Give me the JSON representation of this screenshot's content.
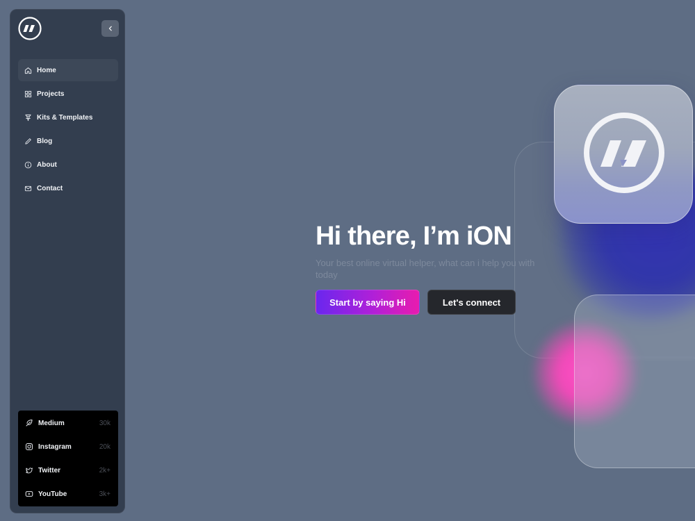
{
  "sidebar": {
    "logo_icon": "double-slash-logo-icon",
    "collapse_icon": "chevron-left-icon",
    "nav": [
      {
        "label": "Home",
        "icon": "home-icon",
        "active": true
      },
      {
        "label": "Projects",
        "icon": "grid-icon",
        "active": false
      },
      {
        "label": "Kits & Templates",
        "icon": "pen-nib-icon",
        "active": false
      },
      {
        "label": "Blog",
        "icon": "pencil-icon",
        "active": false
      },
      {
        "label": "About",
        "icon": "info-icon",
        "active": false
      },
      {
        "label": "Contact",
        "icon": "mail-icon",
        "active": false
      }
    ],
    "socials": [
      {
        "label": "Medium",
        "count": "30k",
        "icon": "feather-icon"
      },
      {
        "label": "Instagram",
        "count": "20k",
        "icon": "instagram-icon"
      },
      {
        "label": "Twitter",
        "count": "2k+",
        "icon": "twitter-icon"
      },
      {
        "label": "YouTube",
        "count": "3k+",
        "icon": "youtube-icon"
      }
    ]
  },
  "hero": {
    "title": "Hi there, I’m  iON",
    "subtitle": "Your best online virtual helper, what can i help you with today",
    "primary_button": "Start by saying Hi",
    "secondary_button": "Let's connect"
  },
  "colors": {
    "background": "#5e6d84",
    "sidebar": "#333e4f",
    "accent_gradient_start": "#6a27ee",
    "accent_gradient_end": "#e81cae",
    "secondary_button": "#25272c"
  }
}
